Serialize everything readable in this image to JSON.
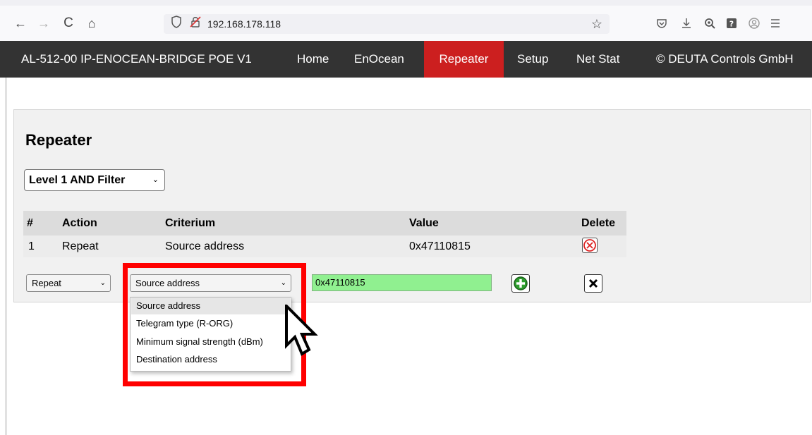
{
  "browser": {
    "back_icon": "←",
    "forward_icon": "→",
    "reload_icon": "C",
    "home_icon": "⌂",
    "url": "192.168.178.118",
    "bookmark_icon": "☆",
    "toolbar_icons": [
      "pocket-icon",
      "download-icon",
      "zoom-icon",
      "help-icon",
      "account-icon",
      "menu-icon"
    ]
  },
  "nav": {
    "brand": "AL-512-00 IP-ENOCEAN-BRIDGE POE V1",
    "items": [
      "Home",
      "EnOcean",
      "Repeater",
      "Setup",
      "Net Stat"
    ],
    "active": "Repeater",
    "copyright": "© DEUTA Controls GmbH",
    "active_color": "#cc1f1f"
  },
  "page": {
    "title": "Repeater",
    "level_select": "Level 1 AND Filter"
  },
  "table": {
    "headers": [
      "#",
      "Action",
      "Criterium",
      "Value",
      "Delete"
    ],
    "rows": [
      {
        "num": "1",
        "action": "Repeat",
        "criterium": "Source address",
        "value": "0x47110815"
      }
    ]
  },
  "edit_row": {
    "action": "Repeat",
    "criterium": "Source address",
    "value": "0x47110815"
  },
  "dropdown": {
    "options": [
      "Source address",
      "Telegram type (R-ORG)",
      "Minimum signal strength (dBm)",
      "Destination address"
    ],
    "highlighted": "Source address"
  }
}
